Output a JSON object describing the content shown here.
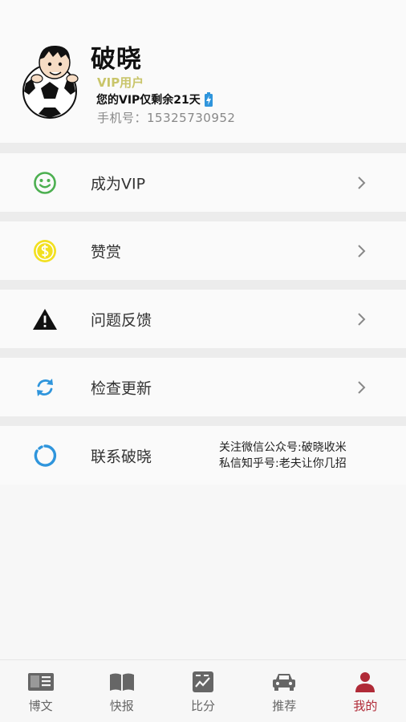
{
  "profile": {
    "name": "破晓",
    "vip_tag": "VIP用户",
    "vip_remaining": "您的VIP仅剩余21天",
    "phone": "手机号：15325730952"
  },
  "menu": [
    {
      "label": "成为VIP",
      "icon": "smiley-icon",
      "icon_color": "#4caf50"
    },
    {
      "label": "赞赏",
      "icon": "coin-dollar-icon",
      "icon_color": "#f2e020"
    },
    {
      "label": "问题反馈",
      "icon": "warning-triangle-icon",
      "icon_color": "#111111"
    },
    {
      "label": "检查更新",
      "icon": "refresh-icon",
      "icon_color": "#2f95dc"
    },
    {
      "label": "联系破晓",
      "icon": "circle-ring-icon",
      "icon_color": "#2f95dc"
    }
  ],
  "contact_note": {
    "line1": "关注微信公众号:破晓收米",
    "line2": "私信知乎号:老夫让你几招"
  },
  "bottom_nav": [
    {
      "label": "博文",
      "icon": "newspaper-icon",
      "active": false
    },
    {
      "label": "快报",
      "icon": "open-book-icon",
      "active": false
    },
    {
      "label": "比分",
      "icon": "score-chart-icon",
      "active": false
    },
    {
      "label": "推荐",
      "icon": "car-icon",
      "active": false
    },
    {
      "label": "我的",
      "icon": "person-icon",
      "active": true
    }
  ],
  "colors": {
    "vip_gold": "#c9c56a",
    "active_tab": "#b02a37",
    "battery_blue": "#2f95dc"
  }
}
